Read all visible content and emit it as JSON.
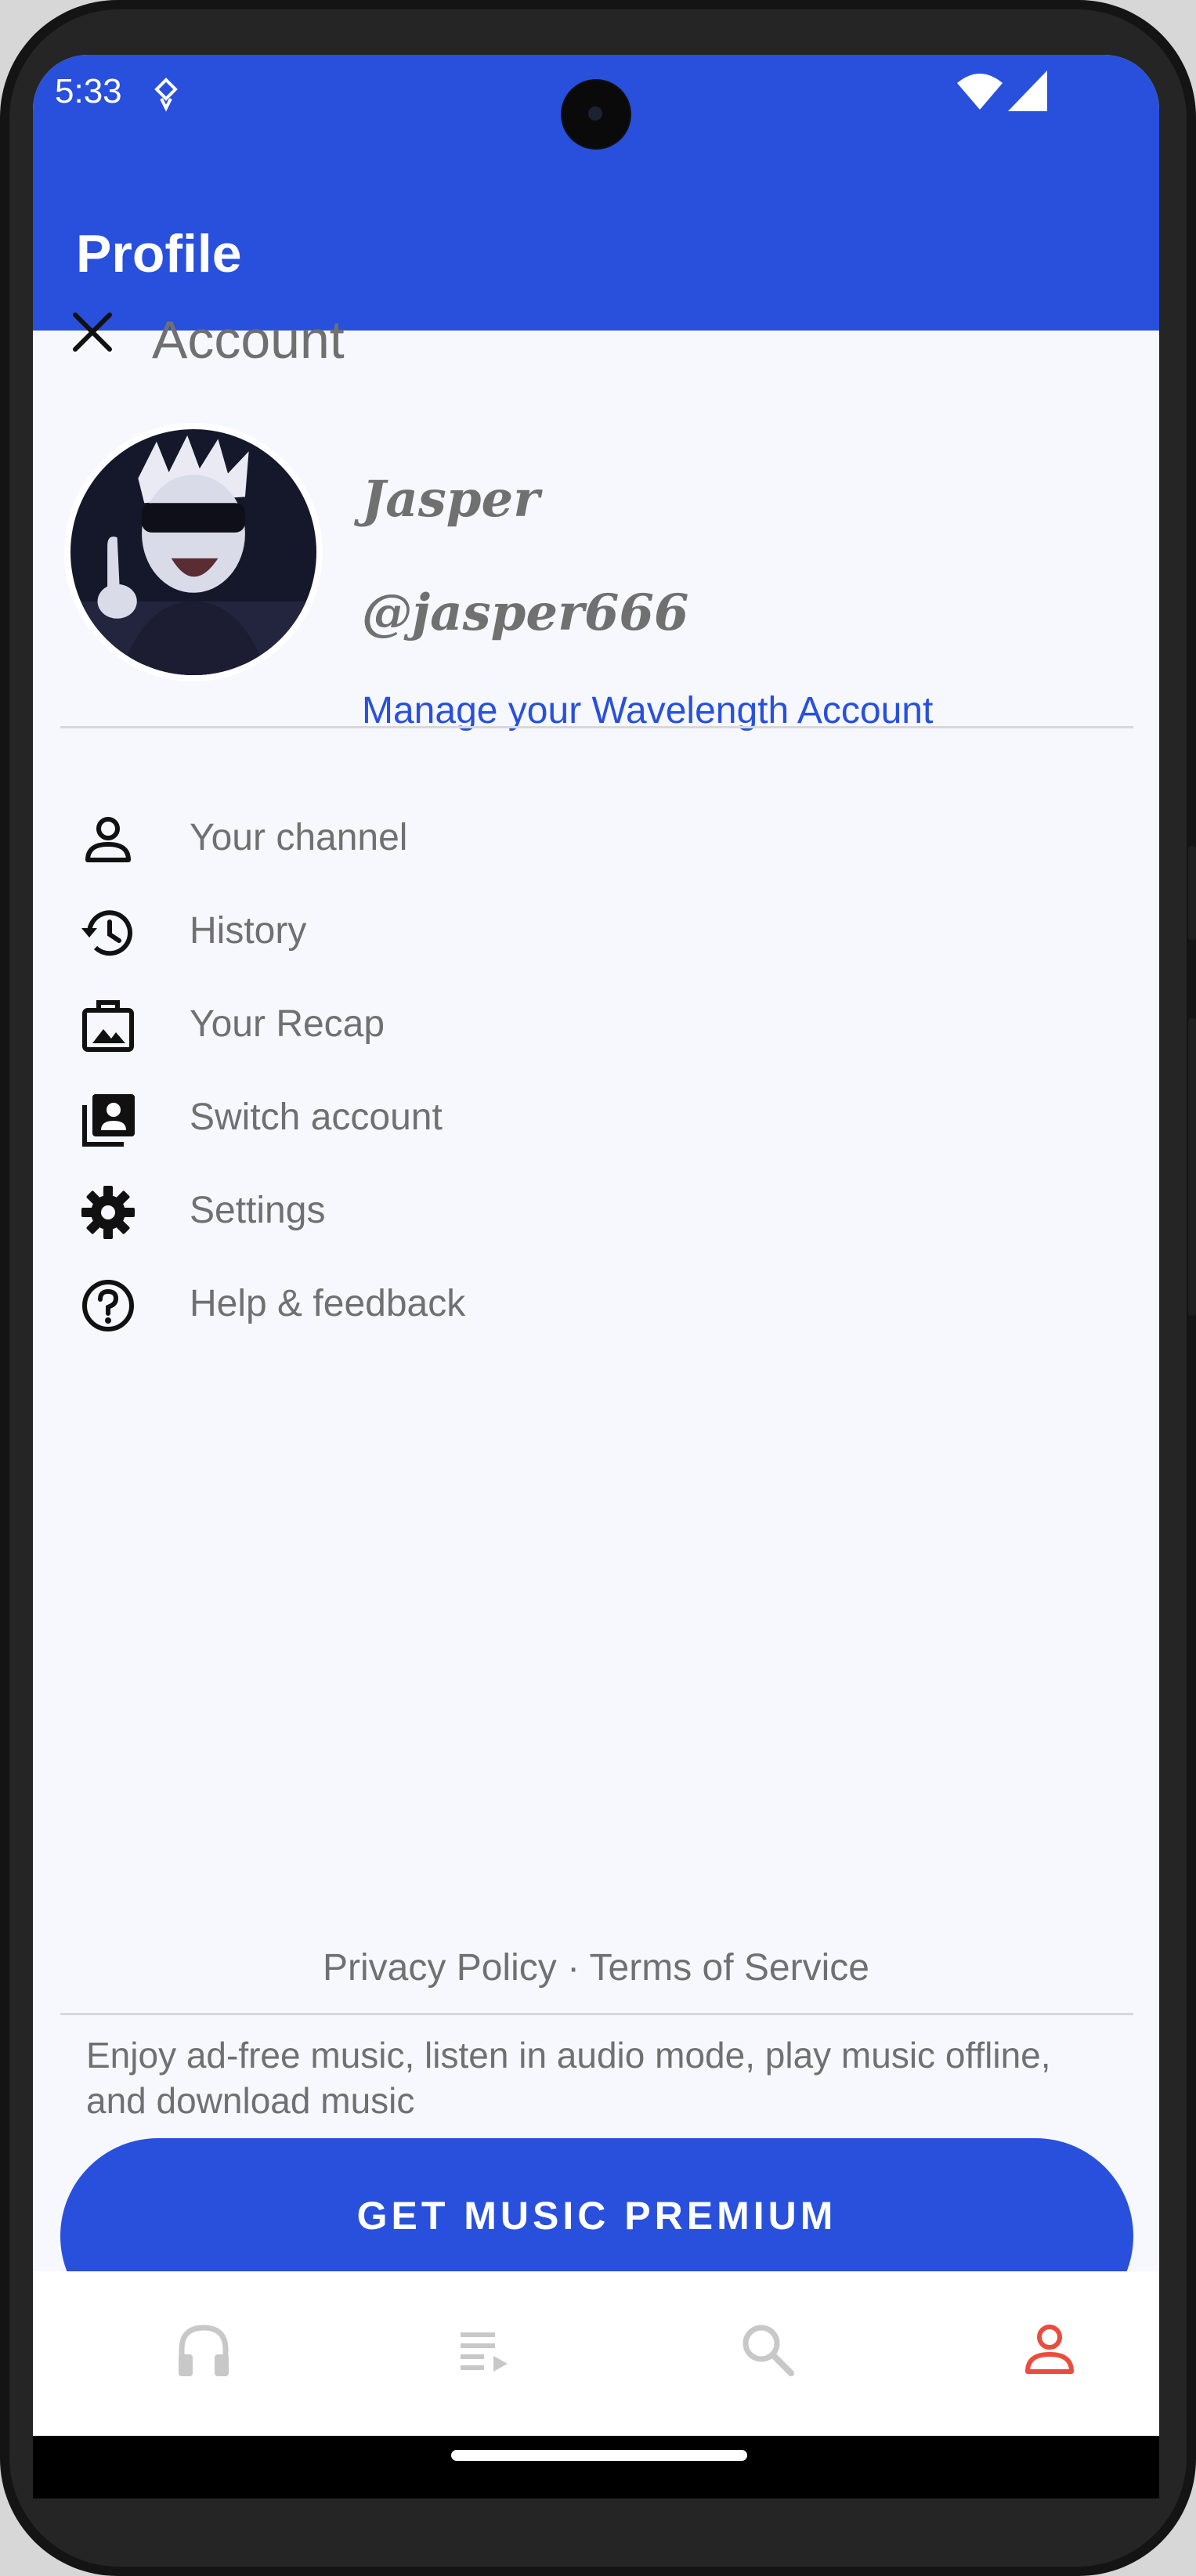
{
  "status_bar": {
    "time": "5:33",
    "notification_icon": "hearing-aid-icon",
    "wifi_icon": "wifi-icon",
    "signal_icon": "cell-signal-icon"
  },
  "app_bar": {
    "title": "Profile"
  },
  "account": {
    "close_icon": "close-icon",
    "title": "Account",
    "name": "Jasper",
    "handle": "@jasper666",
    "manage_link": "Manage your Wavelength Account"
  },
  "menu": {
    "items": [
      {
        "label": "Your channel",
        "icon": "person-icon"
      },
      {
        "label": "History",
        "icon": "history-icon"
      },
      {
        "label": "Your Recap",
        "icon": "recap-icon"
      },
      {
        "label": "Switch account",
        "icon": "switch-account-icon"
      },
      {
        "label": "Settings",
        "icon": "gear-icon"
      },
      {
        "label": "Help & feedback",
        "icon": "help-icon"
      }
    ]
  },
  "footer": {
    "privacy": "Privacy Policy",
    "separator": " · ",
    "terms": "Terms of Service",
    "premium_description": "Enjoy ad-free music, listen in audio mode, play music offline, and download music",
    "premium_button": "GET MUSIC PREMIUM"
  },
  "bottom_nav": {
    "items": [
      {
        "icon": "headphones-icon",
        "active": false
      },
      {
        "icon": "queue-icon",
        "active": false
      },
      {
        "icon": "search-icon",
        "active": false
      },
      {
        "icon": "profile-icon",
        "active": true
      }
    ]
  },
  "colors": {
    "accent": "#2850dd",
    "active_nav": "#ea4d3c",
    "inactive_nav": "#c8c8c8",
    "text_gray": "#707070",
    "background": "#f7f8fd"
  }
}
